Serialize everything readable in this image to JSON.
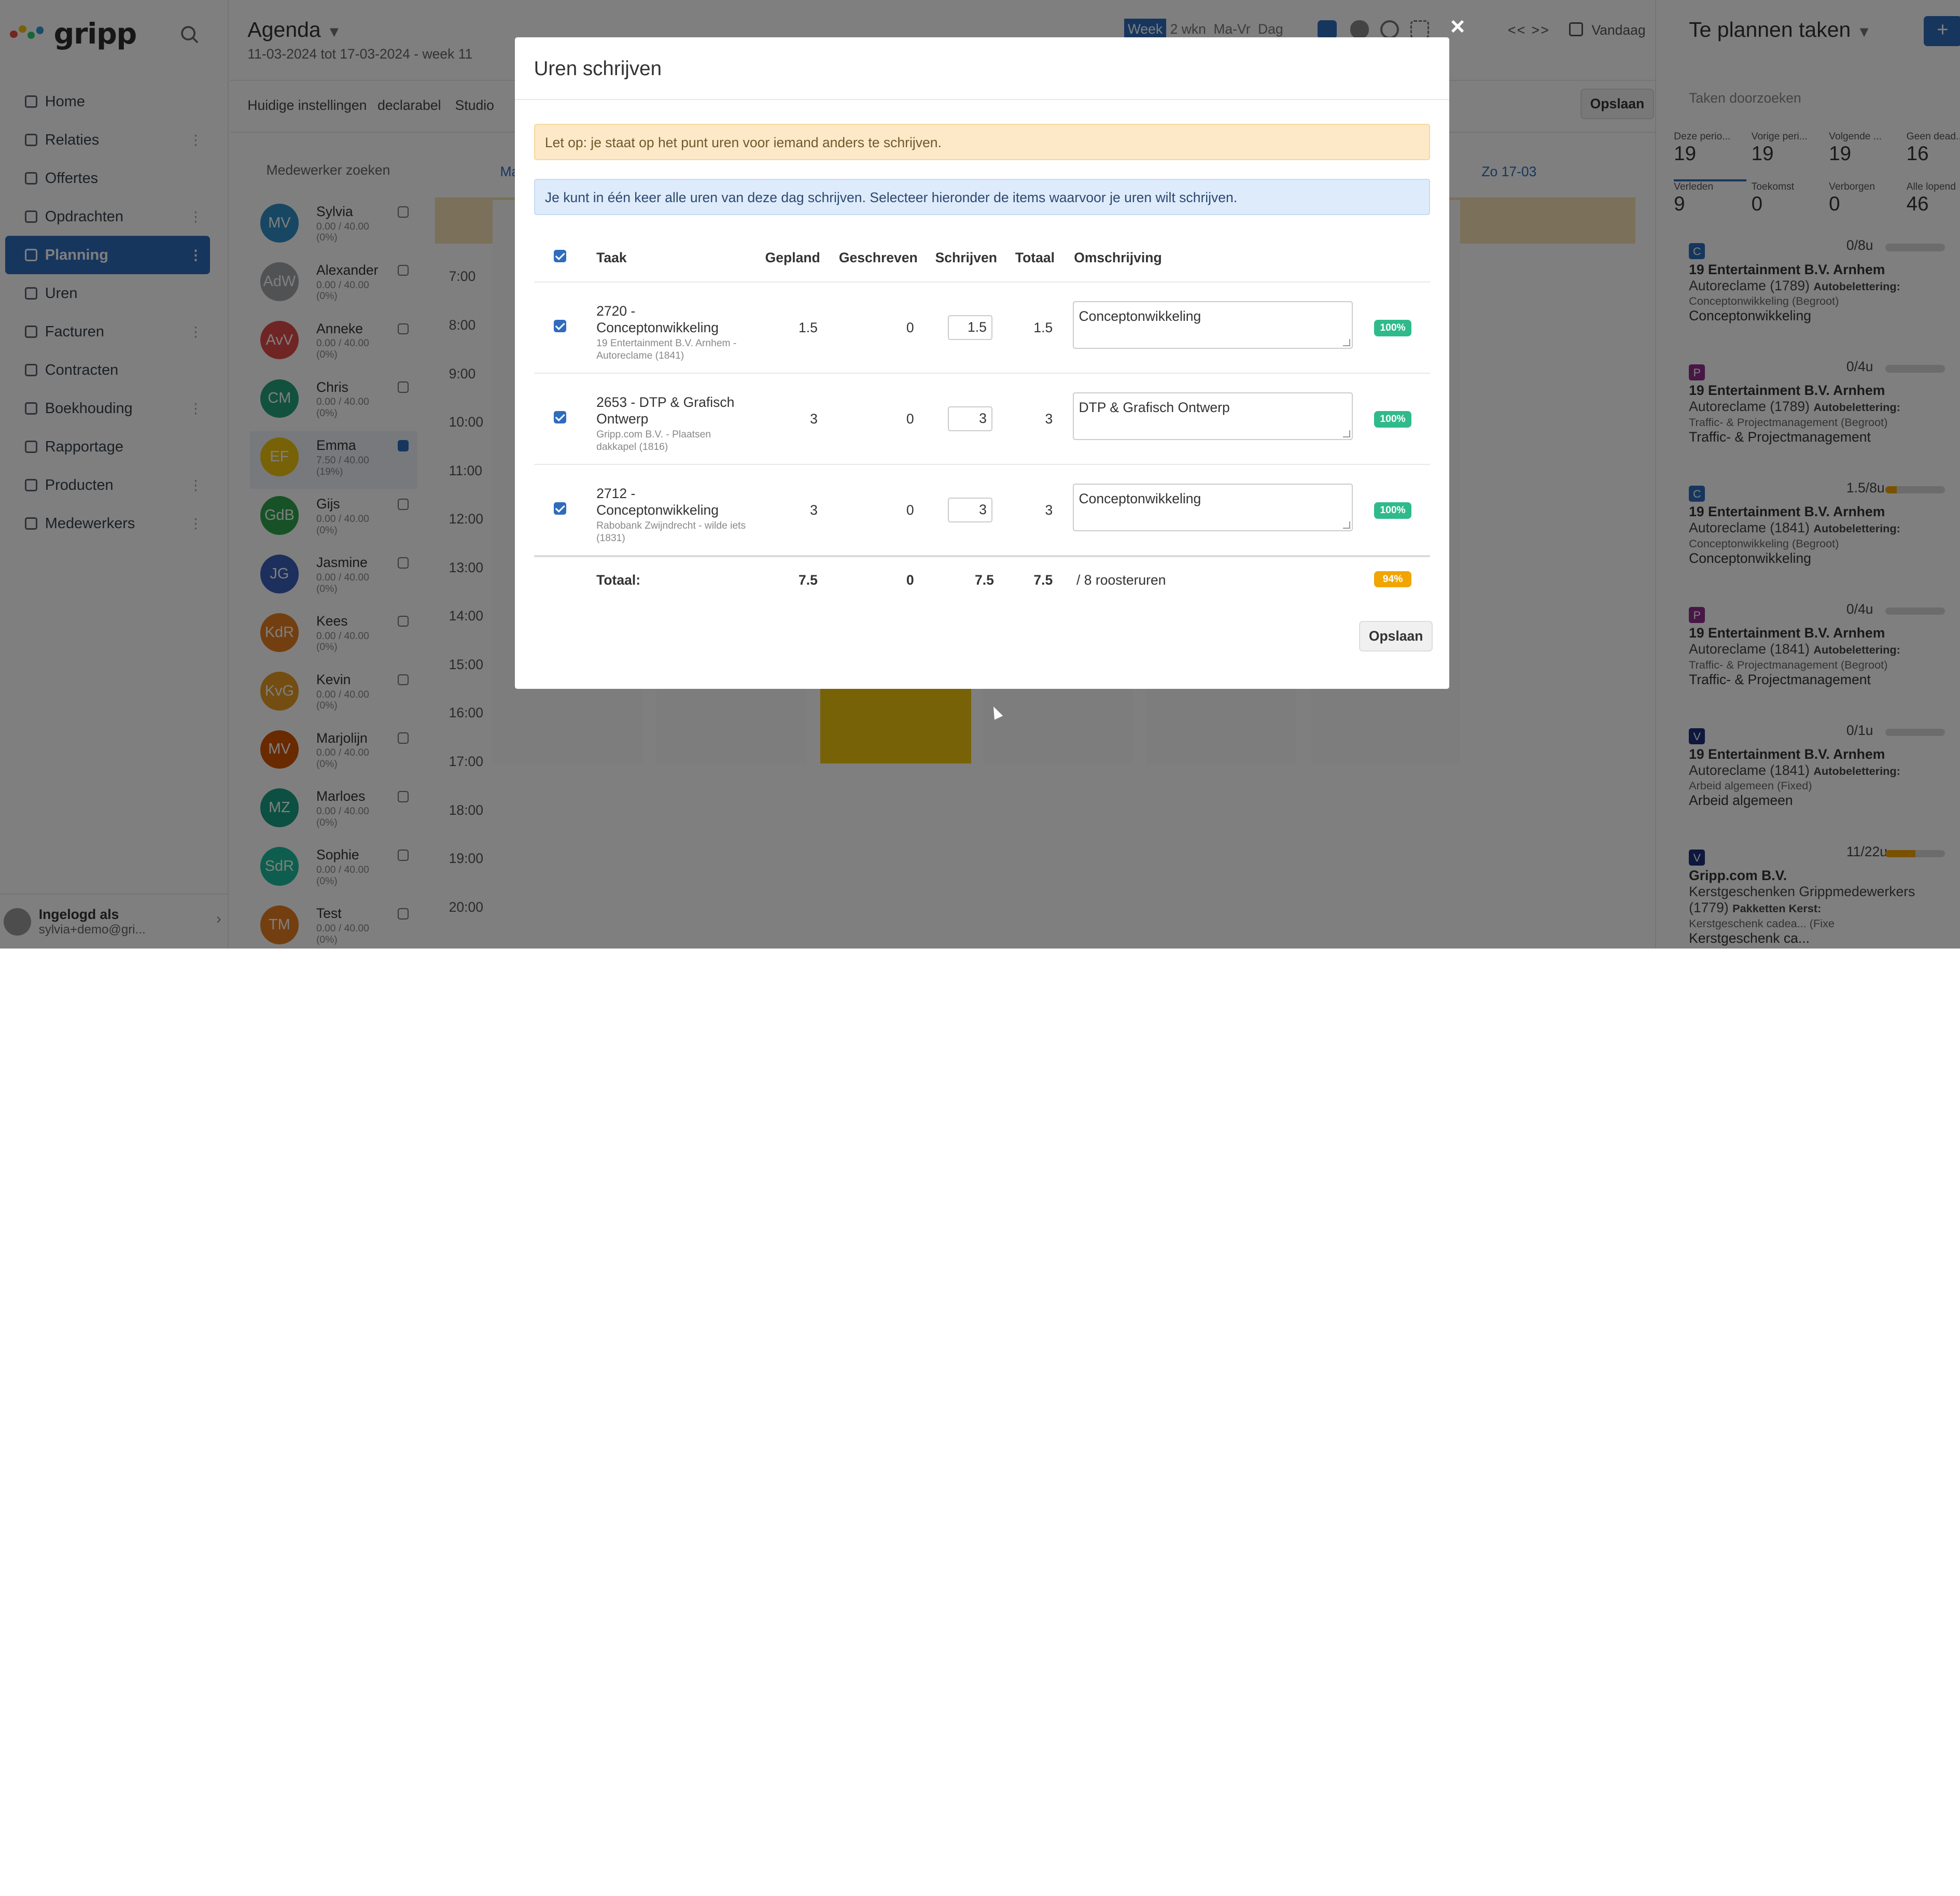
{
  "sidebar": {
    "logo": "gripp",
    "nav": [
      {
        "label": "Home",
        "dots": false
      },
      {
        "label": "Relaties",
        "dots": true
      },
      {
        "label": "Offertes",
        "dots": false
      },
      {
        "label": "Opdrachten",
        "dots": true
      },
      {
        "label": "Planning",
        "dots": true,
        "active": true
      },
      {
        "label": "Uren",
        "dots": false
      },
      {
        "label": "Facturen",
        "dots": true
      },
      {
        "label": "Contracten",
        "dots": false
      },
      {
        "label": "Boekhouding",
        "dots": true
      },
      {
        "label": "Rapportage",
        "dots": false
      },
      {
        "label": "Producten",
        "dots": true
      },
      {
        "label": "Medewerkers",
        "dots": true
      }
    ],
    "user": {
      "label": "Ingelogd als",
      "email": "sylvia+demo@gri..."
    }
  },
  "agenda": {
    "title": "Agenda",
    "subtitle": "11-03-2024 tot 17-03-2024 - week 11",
    "views": [
      "Week",
      "2 wkn",
      "Ma-Vr",
      "Dag"
    ],
    "prev": "<<",
    "next": ">>",
    "today": "Vandaag",
    "tabs": [
      "Huidige instellingen",
      "declarabel",
      "Studio"
    ],
    "save": "Opslaan",
    "employee_search": "Medewerker zoeken",
    "day_headers": {
      "first": "Ma",
      "last": "Zo 17-03"
    },
    "times": [
      "7:00",
      "8:00",
      "9:00",
      "10:00",
      "11:00",
      "12:00",
      "13:00",
      "14:00",
      "15:00",
      "16:00",
      "17:00",
      "18:00",
      "19:00",
      "20:00"
    ],
    "employees": [
      {
        "initials": "MV",
        "name": "Sylvia",
        "hours": "0.00 / 40.00",
        "pct": "(0%)",
        "color": "#2f8fc4",
        "checked": false
      },
      {
        "initials": "AdW",
        "name": "Alexander",
        "hours": "0.00 / 40.00",
        "pct": "(0%)",
        "color": "#a0a4a8",
        "checked": false
      },
      {
        "initials": "AvV",
        "name": "Anneke",
        "hours": "0.00 / 40.00",
        "pct": "(0%)",
        "color": "#e04b4b",
        "checked": false
      },
      {
        "initials": "CM",
        "name": "Chris",
        "hours": "0.00 / 40.00",
        "pct": "(0%)",
        "color": "#24a37b",
        "checked": false
      },
      {
        "initials": "EF",
        "name": "Emma",
        "hours": "7.50 / 40.00",
        "pct": "(19%)",
        "color": "#f1c40f",
        "checked": true
      },
      {
        "initials": "GdB",
        "name": "Gijs",
        "hours": "0.00 / 40.00",
        "pct": "(0%)",
        "color": "#2ea44f",
        "checked": false
      },
      {
        "initials": "JG",
        "name": "Jasmine",
        "hours": "0.00 / 40.00",
        "pct": "(0%)",
        "color": "#3b5fb8",
        "checked": false
      },
      {
        "initials": "KdR",
        "name": "Kees",
        "hours": "0.00 / 40.00",
        "pct": "(0%)",
        "color": "#e67e22",
        "checked": false
      },
      {
        "initials": "KvG",
        "name": "Kevin",
        "hours": "0.00 / 40.00",
        "pct": "(0%)",
        "color": "#e69a22",
        "checked": false
      },
      {
        "initials": "MV",
        "name": "Marjolijn",
        "hours": "0.00 / 40.00",
        "pct": "(0%)",
        "color": "#d35400",
        "checked": false
      },
      {
        "initials": "MZ",
        "name": "Marloes",
        "hours": "0.00 / 40.00",
        "pct": "(0%)",
        "color": "#16a085",
        "checked": false
      },
      {
        "initials": "SdR",
        "name": "Sophie",
        "hours": "0.00 / 40.00",
        "pct": "(0%)",
        "color": "#1abc9c",
        "checked": false
      },
      {
        "initials": "TM",
        "name": "Test",
        "hours": "0.00 / 40.00",
        "pct": "(0%)",
        "color": "#e67e22",
        "checked": false
      }
    ]
  },
  "tasks_panel": {
    "title": "Te plannen taken",
    "add": "+",
    "search": "Taken doorzoeken",
    "stats": [
      {
        "label": "Deze perio...",
        "value": "19",
        "selected": true
      },
      {
        "label": "Vorige peri...",
        "value": "19"
      },
      {
        "label": "Volgende ...",
        "value": "19"
      },
      {
        "label": "Geen dead...",
        "value": "16"
      },
      {
        "label": "Verleden",
        "value": "9"
      },
      {
        "label": "Toekomst",
        "value": "0"
      },
      {
        "label": "Verborgen",
        "value": "0"
      },
      {
        "label": "Alle lopend",
        "value": "46"
      }
    ],
    "tasks": [
      {
        "badge": "C",
        "badge_color": "#2f6cbd",
        "hours": "0/8u",
        "progress": 0,
        "company": "19 Entertainment B.V. Arnhem",
        "project": "Autoreclame (1789)",
        "extra": "Autobelettering:",
        "sub": "Conceptonwikkeling  (Begroot)",
        "desc": "Conceptonwikkeling"
      },
      {
        "badge": "P",
        "badge_color": "#8e2e8a",
        "hours": "0/4u",
        "progress": 0,
        "company": "19 Entertainment B.V. Arnhem",
        "project": "Autoreclame (1789)",
        "extra": "Autobelettering:",
        "sub": "Traffic- & Projectmanagement  (Begroot)",
        "desc": "Traffic- & Projectmanagement"
      },
      {
        "badge": "C",
        "badge_color": "#2f6cbd",
        "hours": "1.5/8u",
        "progress": 0.19,
        "company": "19 Entertainment B.V. Arnhem",
        "project": "Autoreclame (1841)",
        "extra": "Autobelettering:",
        "sub": "Conceptonwikkeling  (Begroot)",
        "desc": "Conceptonwikkeling"
      },
      {
        "badge": "P",
        "badge_color": "#8e2e8a",
        "hours": "0/4u",
        "progress": 0,
        "company": "19 Entertainment B.V. Arnhem",
        "project": "Autoreclame (1841)",
        "extra": "Autobelettering:",
        "sub": "Traffic- & Projectmanagement  (Begroot)",
        "desc": "Traffic- & Projectmanagement"
      },
      {
        "badge": "V",
        "badge_color": "#1c2e7a",
        "hours": "0/1u",
        "progress": 0,
        "company": "19 Entertainment B.V. Arnhem",
        "project": "Autoreclame (1841)",
        "extra": "Autobelettering:",
        "sub": "Arbeid algemeen  (Fixed)",
        "desc": "Arbeid algemeen"
      },
      {
        "badge": "V",
        "badge_color": "#1c2e7a",
        "hours": "11/22u",
        "progress": 0.5,
        "company": "Gripp.com B.V.",
        "project": "Kerstgeschenken Grippmedewerkers (1779)",
        "extra": "Pakketten Kerst:",
        "sub": "Kerstgeschenk cadea...  (Fixe",
        "desc": "Kerstgeschenk ca..."
      }
    ]
  },
  "modal": {
    "title": "Uren schrijven",
    "close": "×",
    "warning": "Let op: je staat op het punt uren voor iemand anders te schrijven.",
    "info": "Je kunt in één keer alle uren van deze dag schrijven. Selecteer hieronder de items waarvoor je uren wilt schrijven.",
    "headers": {
      "task": "Taak",
      "planned": "Gepland",
      "written": "Geschreven",
      "write": "Schrijven",
      "total": "Totaal",
      "description": "Omschrijving"
    },
    "rows": [
      {
        "task": "2720 - Conceptonwikkeling",
        "sub": "19 Entertainment B.V. Arnhem - Autoreclame (1841)",
        "planned": "1.5",
        "written": "0",
        "write": "1.5",
        "total": "1.5",
        "description": "Conceptonwikkeling",
        "pct": "100%"
      },
      {
        "task": "2653 - DTP & Grafisch Ontwerp",
        "sub": "Gripp.com B.V. - Plaatsen dakkapel (1816)",
        "planned": "3",
        "written": "0",
        "write": "3",
        "total": "3",
        "description": "DTP & Grafisch Ontwerp",
        "pct": "100%"
      },
      {
        "task": "2712 - Conceptonwikkeling",
        "sub": "Rabobank Zwijndrecht - wilde iets (1831)",
        "planned": "3",
        "written": "0",
        "write": "3",
        "total": "3",
        "description": "Conceptonwikkeling",
        "pct": "100%"
      }
    ],
    "totals": {
      "label": "Totaal:",
      "planned": "7.5",
      "written": "0",
      "write": "7.5",
      "total": "7.5",
      "roster": "/ 8 roosteruren",
      "pct": "94%"
    },
    "save": "Opslaan"
  },
  "colors": {
    "accent": "#2f6cbd",
    "success": "#2fba8c",
    "warning": "#f0a500"
  }
}
